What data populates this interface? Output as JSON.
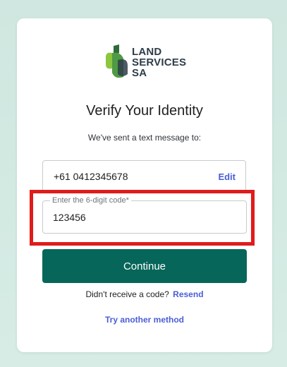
{
  "brand": {
    "logo_lines": [
      "LAND",
      "SERVICES",
      "SA"
    ],
    "logo_colors": {
      "dark_green": "#2f6b3a",
      "light_green": "#8cc63f",
      "mid_green": "#4f9a44",
      "text": "#2e3d49"
    }
  },
  "page": {
    "title": "Verify Your Identity",
    "subtitle": "We've sent a text message to:"
  },
  "phone": {
    "number": "+61 0412345678",
    "edit_label": "Edit"
  },
  "code_field": {
    "label": "Enter the 6-digit code*",
    "value": "123456"
  },
  "actions": {
    "continue_label": "Continue",
    "resend_prompt": "Didn't receive a code?",
    "resend_label": "Resend",
    "try_another_label": "Try another method"
  },
  "colors": {
    "primary_button": "#06665a",
    "link": "#4a5ed6",
    "highlight": "#e01b1b",
    "background": "#cfe7e0"
  }
}
